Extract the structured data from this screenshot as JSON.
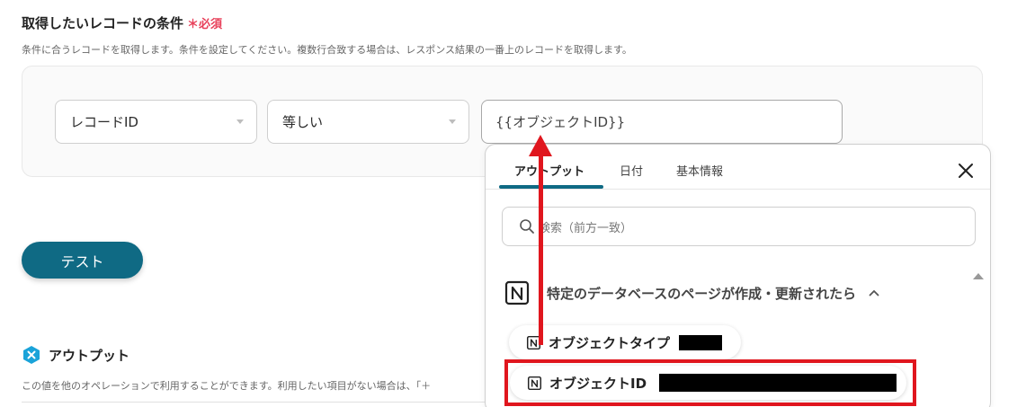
{
  "section": {
    "title": "取得したいレコードの条件",
    "required_label": "＊必須",
    "description": "条件に合うレコードを取得します。条件を設定してください。複数行合致する場合は、レスポンス結果の一番上のレコードを取得します。"
  },
  "condition": {
    "field_select": "レコードID",
    "operator_select": "等しい",
    "value": "{{オブジェクトID}}"
  },
  "test_button": "テスト",
  "output": {
    "title": "アウトプット",
    "description": "この値を他のオペレーションで利用することができます。利用したい項目がない場合は、「＋"
  },
  "popup": {
    "tabs": [
      {
        "label": "アウトプット",
        "active": true
      },
      {
        "label": "日付",
        "active": false
      },
      {
        "label": "基本情報",
        "active": false
      }
    ],
    "search_placeholder": "検索（前方一致）",
    "source_label": "特定のデータベースのページが作成・更新されたら",
    "items": [
      {
        "label": "オブジェクトタイプ"
      },
      {
        "label": "オブジェクトID"
      }
    ]
  },
  "colors": {
    "accent": "#0f6a84",
    "required": "#e8405a",
    "annotation": "#e0161e"
  },
  "icons": [
    "caret-down-icon",
    "output-badge-icon",
    "close-icon",
    "search-icon",
    "notion-icon",
    "chevron-up-icon",
    "scroll-up-icon",
    "arrow-up-annotation"
  ]
}
